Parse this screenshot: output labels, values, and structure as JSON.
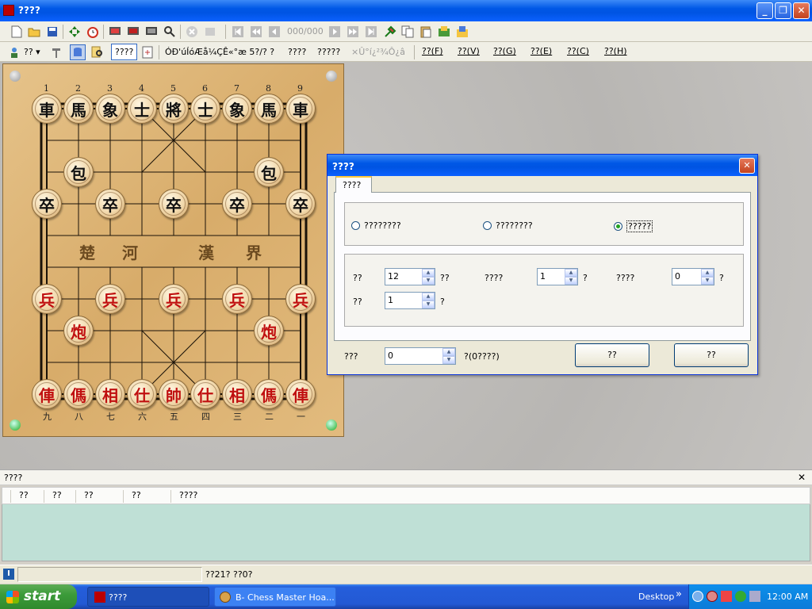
{
  "window": {
    "title": "????",
    "btn_min": "_",
    "btn_max": "❐",
    "btn_close": "✕"
  },
  "toolbar2": {
    "dropdown_label": "?? ▾",
    "analysis_button": "????",
    "garbled_text": "ÓÐ'úÍóÆå¼ÇÊ«°æ 5?/? ?",
    "text_a": "????",
    "text_b": "?????",
    "text_c": "×Û°í¿²¾Ô¿â"
  },
  "navcounter": "000/000",
  "menu": [
    "??(F)",
    "??(V)",
    "??(G)",
    "??(E)",
    "??(C)",
    "??(H)"
  ],
  "board": {
    "top_coords": [
      "1",
      "2",
      "3",
      "4",
      "5",
      "6",
      "7",
      "8",
      "9"
    ],
    "bottom_coords": [
      "九",
      "八",
      "七",
      "六",
      "五",
      "四",
      "三",
      "二",
      "一"
    ],
    "river_left": [
      "楚",
      "河"
    ],
    "river_right": [
      "漢",
      "界"
    ],
    "black_back": [
      "車",
      "馬",
      "象",
      "士",
      "將",
      "士",
      "象",
      "馬",
      "車"
    ],
    "black_cannon": "包",
    "black_pawn": "卒",
    "red_back": [
      "俥",
      "傌",
      "相",
      "仕",
      "帥",
      "仕",
      "相",
      "傌",
      "俥"
    ],
    "red_cannon": "炮",
    "red_pawn": "兵"
  },
  "dialog": {
    "title": "????",
    "tab": "????",
    "radio1": "????????",
    "radio2": "????????",
    "radio3": "?????",
    "row1": {
      "l1": "??",
      "v1": "12",
      "u1": "??",
      "l2": "????",
      "v2": "1",
      "u2": "?",
      "l3": "????",
      "v3": "0",
      "u3": "?"
    },
    "row2": {
      "l1": "??",
      "v1": "1",
      "u1": "?"
    },
    "bottom_label": "???",
    "bottom_value": "0",
    "bottom_unit": "?(0????)",
    "ok_button": "??",
    "cancel_button": "??"
  },
  "panel": {
    "title": "????",
    "close": "✕",
    "columns": [
      "??",
      "??",
      "??",
      "??",
      "????"
    ]
  },
  "status": {
    "icon_text": "I",
    "text": "??21? ??0?"
  },
  "taskbar": {
    "start": "start",
    "task1": "????",
    "task2": "B- Chess Master Hoa...",
    "desktop": "Desktop",
    "chevron": "»",
    "time": "12:00 AM"
  },
  "colors": {
    "board_wood": "#deb576",
    "red_piece": "#c01010",
    "black_piece": "#111111",
    "table_body": "#bfe0d6"
  }
}
